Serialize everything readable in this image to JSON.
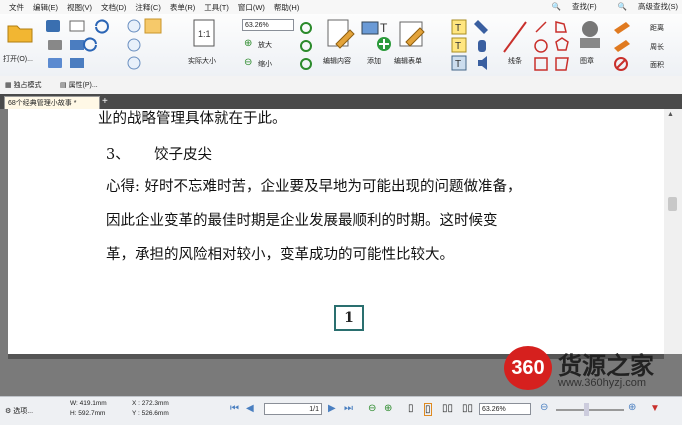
{
  "menu": [
    "文件",
    "编辑(E)",
    "视图(V)",
    "文档(D)",
    "注释(C)",
    "表单(R)",
    "工具(T)",
    "窗口(W)",
    "帮助(H)"
  ],
  "menu_right": {
    "find": "查找(F)",
    "adv_find": "高级查找(S)"
  },
  "ribbon": {
    "open_label": "打开(O)...",
    "actual_size": "实际大小",
    "zoom_value": "63.26%",
    "zoom_in": "放大",
    "zoom_out": "缩小",
    "edit_content": "编辑内容",
    "add": "添加",
    "edit_form": "编辑表单",
    "line": "线条",
    "stamp": "图章",
    "distance": "距离",
    "perimeter": "周长",
    "area": "面积"
  },
  "subbar": {
    "exclusive_mode": "独占模式",
    "properties": "属性(P)..."
  },
  "tab": {
    "title": "68个经典管理小故事 *"
  },
  "document": {
    "line0": "业的战略管理具体就在于此。",
    "heading_num": "3、",
    "heading_text": "饺子皮尖",
    "line1": "心得: 好时不忘难时苦，企业要及早地为可能出现的问题做准备，",
    "line2": "因此企业变革的最佳时期是企业发展最顺利的时期。这时候变",
    "line3": "革，承担的风险相对较小，变革成功的可能性比较大。",
    "page_number": "1"
  },
  "status": {
    "options": "选项...",
    "width": "W: 419.1mm",
    "height": "H: 592.7mm",
    "x": "X : 272.3mm",
    "y": "Y : 526.6mm",
    "page": "1",
    "page_total": "1",
    "zoom": "63.26%"
  },
  "watermark": {
    "badge": "360",
    "name": "货源之家",
    "url": "www.360hyzj.com"
  },
  "colors": {
    "tab_bar": "#4a4a4a",
    "doc_bg": "#7a7a7a",
    "brand_red": "#d6201e",
    "pagenum_border": "#2a6f6f"
  }
}
